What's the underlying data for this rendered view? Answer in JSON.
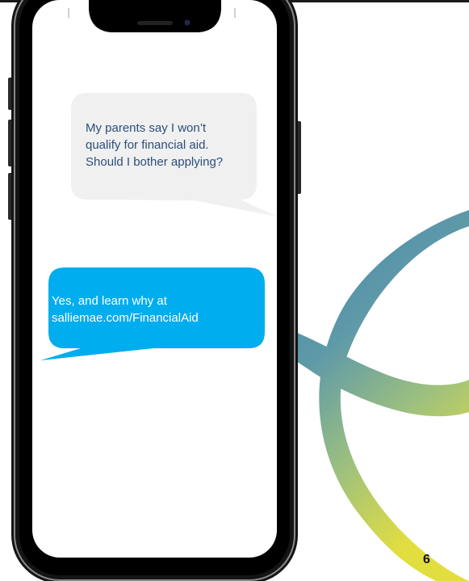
{
  "messages": {
    "incoming": "My parents say I won’t\nqualify for financial aid.\nShould I bother applying?",
    "outgoing": "Yes, and learn why at\nsalliemae.com/FinancialAid"
  },
  "page": {
    "number": "6"
  },
  "colors": {
    "incoming_bubble": "#f0f0f0",
    "incoming_text": "#2a4f7a",
    "outgoing_bubble": "#00adee",
    "outgoing_text": "#ffffff",
    "ribbon_start": "#3d7fb0",
    "ribbon_mid": "#8ab898",
    "ribbon_end": "#dede45"
  }
}
